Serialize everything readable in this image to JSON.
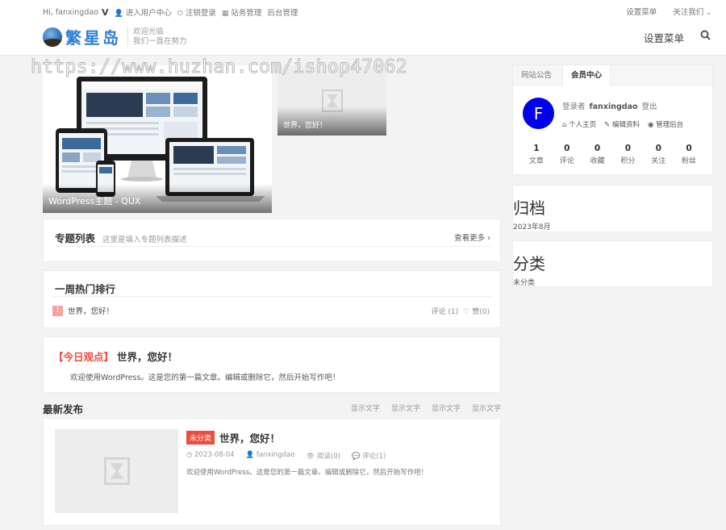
{
  "topbar": {
    "greeting": "Hi, fanxingdao",
    "vip_badge": "V",
    "links": [
      "进入用户中心",
      "注销登录",
      "站务管理",
      "后台管理"
    ],
    "right_links": [
      "设置菜单",
      "关注我们"
    ]
  },
  "header": {
    "logo_text": "繁星岛",
    "slogan_line1": "欢迎光临",
    "slogan_line2": "我们一直在努力",
    "menu_label": "设置菜单"
  },
  "watermark": "https://www.huzhan.com/ishop47062",
  "slider": {
    "main_caption": "WordPress主题 - QUX",
    "side_caption": "世界，您好！"
  },
  "topics": {
    "title": "专题列表",
    "desc": "这里是填入专题列表描述",
    "more": "查看更多"
  },
  "hot": {
    "title": "一周热门排行",
    "items": [
      {
        "rank": "1",
        "title": "世界，您好！",
        "comments": "评论 (1)",
        "likes": "赞(0)"
      }
    ]
  },
  "opinion": {
    "label": "【今日观点】",
    "title": "世界，您好！",
    "body": "欢迎使用WordPress。这是您的第一篇文章。编辑或删除它，然后开始写作吧！"
  },
  "latest": {
    "title": "最新发布",
    "tabs": [
      "显示文字",
      "显示文字",
      "显示文字",
      "显示文字"
    ]
  },
  "post": {
    "category": "未分类",
    "title": "世界，您好！",
    "date": "2023-08-04",
    "author": "fanxingdao",
    "views": "阅读(0)",
    "comments": "评论(1)",
    "excerpt": "欢迎使用WordPress。这是您的第一篇文章。编辑或删除它，然后开始写作吧！"
  },
  "sidebar": {
    "tabs": [
      "网站公告",
      "会员中心"
    ],
    "avatar_letter": "F",
    "login_prefix": "登录者",
    "username": "fanxingdao",
    "logout": "登出",
    "links": [
      "个人主页",
      "编辑资料",
      "管理后台"
    ],
    "stats": [
      {
        "value": "1",
        "label": "文章"
      },
      {
        "value": "0",
        "label": "评论"
      },
      {
        "value": "0",
        "label": "收藏"
      },
      {
        "value": "0",
        "label": "积分"
      },
      {
        "value": "0",
        "label": "关注"
      },
      {
        "value": "0",
        "label": "粉丝"
      }
    ],
    "archive_title": "归档",
    "archive_item": "2023年8月",
    "category_title": "分类",
    "category_item": "未分类"
  },
  "colors": {
    "accent_red": "#f04c3d",
    "avatar_blue": "#0000ee",
    "logo_blue": "#2e7fd6",
    "rank_badge": "#f7a29b"
  }
}
